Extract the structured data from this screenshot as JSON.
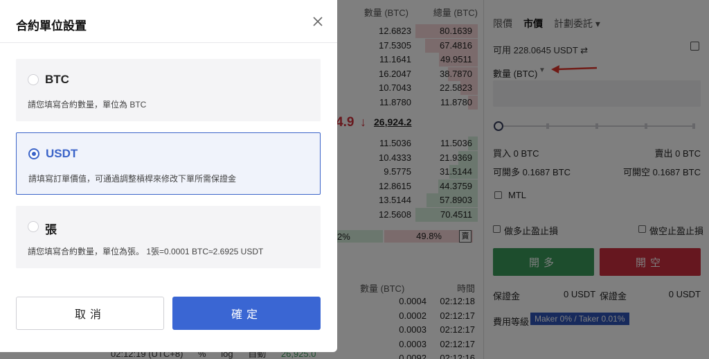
{
  "orderbook": {
    "headers": [
      "數量 (BTC)",
      "總量 (BTC)"
    ],
    "asks": [
      {
        "qty": "12.6823",
        "total": "80.1639",
        "fill": 1.0
      },
      {
        "qty": "17.5305",
        "total": "67.4816",
        "fill": 0.84
      },
      {
        "qty": "11.1641",
        "total": "49.9511",
        "fill": 0.62
      },
      {
        "qty": "16.2047",
        "total": "38.7870",
        "fill": 0.48
      },
      {
        "qty": "10.7043",
        "total": "22.5823",
        "fill": 0.28
      },
      {
        "qty": "11.8780",
        "total": "11.8780",
        "fill": 0.15
      }
    ],
    "mid_price_partial": "4.9",
    "mid_arrow": "↓",
    "mark_price": "26,924.2",
    "bids": [
      {
        "qty": "11.5036",
        "total": "11.5036",
        "fill": 0.16
      },
      {
        "qty": "10.4333",
        "total": "21.9369",
        "fill": 0.31
      },
      {
        "qty": "9.5775",
        "total": "31.5144",
        "fill": 0.45
      },
      {
        "qty": "12.8615",
        "total": "44.3759",
        "fill": 0.63
      },
      {
        "qty": "13.5144",
        "total": "57.8903",
        "fill": 0.82
      },
      {
        "qty": "12.5608",
        "total": "70.4511",
        "fill": 1.0
      }
    ],
    "buy_ratio": "2%",
    "sell_ratio": "49.8%",
    "sell_mark": "賣"
  },
  "trades": {
    "headers": [
      "數量 (BTC)",
      "時間"
    ],
    "rows": [
      {
        "qty": "0.0004",
        "time": "02:12:18"
      },
      {
        "qty": "0.0002",
        "time": "02:12:17"
      },
      {
        "qty": "0.0003",
        "time": "02:12:17"
      },
      {
        "qty": "0.0003",
        "time": "02:12:17"
      },
      {
        "qty": "0.0092",
        "time": "02:12:16"
      }
    ]
  },
  "bottom": {
    "time": "02:12:19 (UTC+8)",
    "pct": "%",
    "log": "log",
    "auto": "自動",
    "price": "26,925.0"
  },
  "trade_panel": {
    "tabs": [
      "限價",
      "市價",
      "計劃委託 ▾"
    ],
    "active_tab": "市價",
    "available": "可用 228.0645 USDT ⇄",
    "qty_label": "數量 (BTC)",
    "buy_amount": "買入 0 BTC",
    "sell_amount": "賣出 0 BTC",
    "can_long": "可開多 0.1687 BTC",
    "can_short": "可開空 0.1687 BTC",
    "mtl": "MTL",
    "long_tpsl": "做多止盈止損",
    "short_tpsl": "做空止盈止損",
    "open_long": "開多",
    "open_short": "開空",
    "margin_label": "保證金",
    "margin_long": "0 USDT",
    "margin_short": "0 USDT",
    "fee_label": "費用等級",
    "fee_value": "Maker 0% / Taker 0.01%",
    "colors": {
      "long": "#3a9b5a",
      "short": "#cc2e3f",
      "accent": "#2e55b8"
    }
  },
  "modal": {
    "title": "合約單位設置",
    "options": [
      {
        "title": "BTC",
        "desc": "請您填寫合約數量，單位為 BTC",
        "selected": false
      },
      {
        "title": "USDT",
        "desc": "請填寫訂單價值，可通過調整槓桿來修改下單所需保證金",
        "selected": true
      },
      {
        "title": "張",
        "desc": "請您填寫合約數量，單位為張。 1張=0.0001 BTC≈2.6925 USDT",
        "selected": false
      }
    ],
    "cancel": "取消",
    "confirm": "確定",
    "accent": "#3a66d3"
  }
}
